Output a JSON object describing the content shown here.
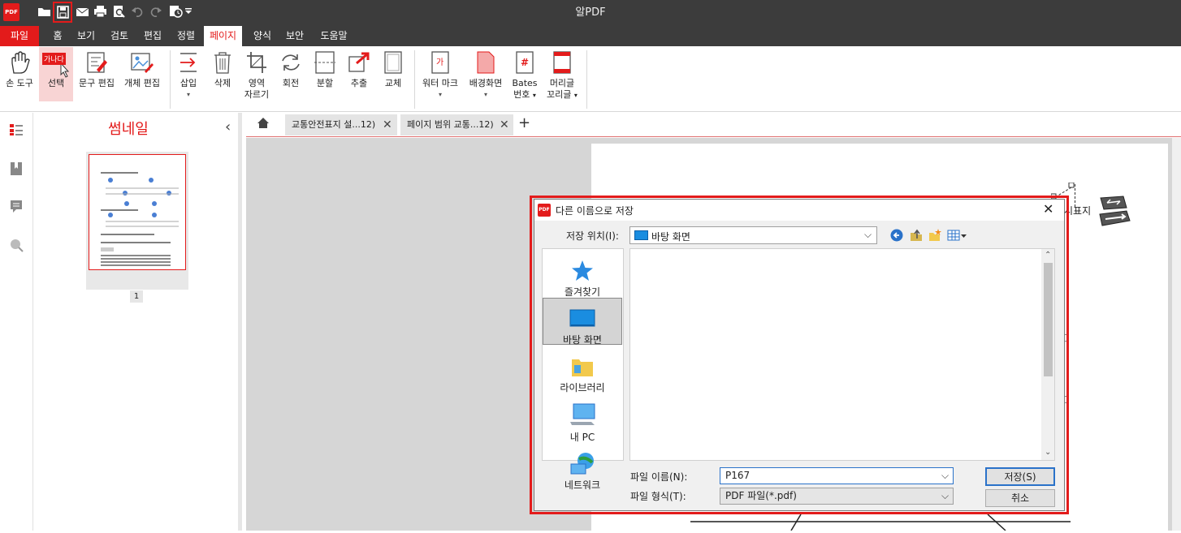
{
  "window": {
    "title": "알PDF"
  },
  "quick_access": {
    "icons": [
      "pdf-logo-icon",
      "open-folder-icon",
      "save-icon",
      "mail-icon",
      "print-icon",
      "print-preview-icon",
      "undo-icon",
      "redo-icon",
      "history-icon",
      "dropdown-icon"
    ]
  },
  "menu": {
    "items": [
      "파일",
      "홈",
      "보기",
      "검토",
      "편집",
      "정렬",
      "페이지",
      "양식",
      "보안",
      "도움말"
    ],
    "active": "페이지"
  },
  "ribbon": {
    "hand_tool": "손 도구",
    "select": "선택",
    "select_badge": "가나다",
    "text_edit": "문구 편집",
    "object_edit": "개체 편집",
    "insert": "삽입",
    "delete": "삭제",
    "crop_line1": "영역",
    "crop_line2": "자르기",
    "rotate": "회전",
    "split": "분할",
    "extract": "추출",
    "replace": "교체",
    "watermark": "워터 마크",
    "background": "배경화면",
    "bates_line1": "Bates",
    "bates_line2": "번호",
    "header_line1": "머리글",
    "header_line2": "꼬리글"
  },
  "thumbnail_panel": {
    "title": "썸네일",
    "page_number": "1"
  },
  "tabs": [
    {
      "label": "교통안전표지 설...12)"
    },
    {
      "label": "페이지 범위 교통...12)"
    }
  ],
  "page_content": {
    "partial_text": "시표지"
  },
  "dialog": {
    "title": "다른 이름으로 저장",
    "location_label": "저장 위치(I):",
    "location_value": "바탕 화면",
    "places": [
      "즐겨찾기",
      "바탕 화면",
      "라이브러리",
      "내 PC",
      "네트워크"
    ],
    "selected_place": "바탕 화면",
    "filename_label": "파일 이름(N):",
    "filename_value": "P167",
    "filetype_label": "파일 형식(T):",
    "filetype_value": "PDF 파일(*.pdf)",
    "save_button": "저장(S)",
    "cancel_button": "취소"
  },
  "colors": {
    "accent": "#e31b1b",
    "titlebar": "#3c3c3c",
    "active_menu_bg": "#ffffff"
  }
}
